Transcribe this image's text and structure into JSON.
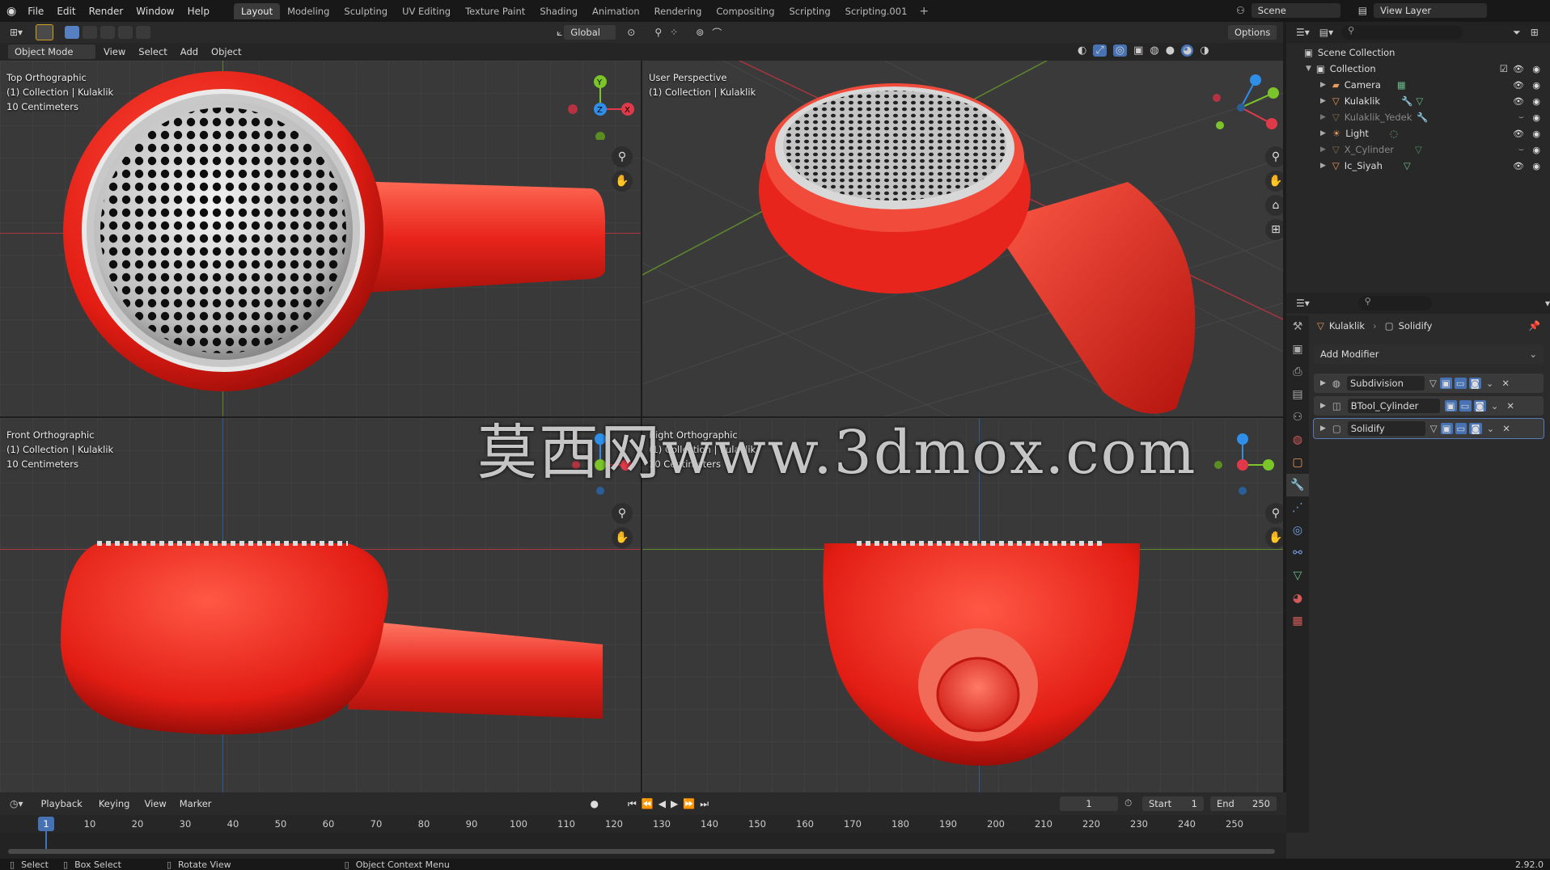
{
  "topbar": {
    "menus": [
      "File",
      "Edit",
      "Render",
      "Window",
      "Help"
    ],
    "workspaces": [
      "Layout",
      "Modeling",
      "Sculpting",
      "UV Editing",
      "Texture Paint",
      "Shading",
      "Animation",
      "Rendering",
      "Compositing",
      "Scripting",
      "Scripting.001"
    ],
    "active_workspace": "Layout",
    "scene": "Scene",
    "view_layer": "View Layer"
  },
  "header3d": {
    "mode": "Object Mode",
    "menus": [
      "View",
      "Select",
      "Add",
      "Object"
    ],
    "transform": "Global",
    "options": "Options"
  },
  "viewports": [
    {
      "name": "Top Orthographic",
      "line2": "(1) Collection | Kulaklik",
      "line3": "10 Centimeters"
    },
    {
      "name": "User Perspective",
      "line2": "(1) Collection | Kulaklik",
      "line3": ""
    },
    {
      "name": "Front Orthographic",
      "line2": "(1) Collection | Kulaklik",
      "line3": "10 Centimeters"
    },
    {
      "name": "Right Orthographic",
      "line2": "(1) Collection | Kulaklik",
      "line3": "10 Centimeters"
    }
  ],
  "gizmo_labels": {
    "x": "X",
    "y": "Y",
    "z": "Z"
  },
  "watermark": "莫西网www.3dmox.com",
  "outliner": {
    "root": "Scene Collection",
    "collection": "Collection",
    "items": [
      "Camera",
      "Kulaklik",
      "Kulaklik_Yedek",
      "Light",
      "X_Cylinder",
      "Ic_Siyah"
    ]
  },
  "properties": {
    "object": "Kulaklik",
    "modifier_ctx": "Solidify",
    "add_modifier": "Add Modifier",
    "modifiers": [
      "Subdivision",
      "BTool_Cylinder",
      "Solidify"
    ]
  },
  "timeline": {
    "menus": [
      "Playback",
      "Keying",
      "View",
      "Marker"
    ],
    "current_frame": "1",
    "start_label": "Start",
    "start": "1",
    "end_label": "End",
    "end": "250",
    "ticks": [
      "1",
      "10",
      "20",
      "30",
      "40",
      "50",
      "60",
      "70",
      "80",
      "90",
      "100",
      "110",
      "120",
      "130",
      "140",
      "150",
      "160",
      "170",
      "180",
      "190",
      "200",
      "210",
      "220",
      "230",
      "240",
      "250"
    ]
  },
  "status": {
    "select": "Select",
    "box_select": "Box Select",
    "rotate": "Rotate View",
    "context": "Object Context Menu",
    "version": "2.92.0"
  },
  "colors": {
    "red_body": "#e8251c",
    "x_axis": "#e03a4a",
    "y_axis": "#7bc42a",
    "z_axis": "#2f8ee8"
  }
}
